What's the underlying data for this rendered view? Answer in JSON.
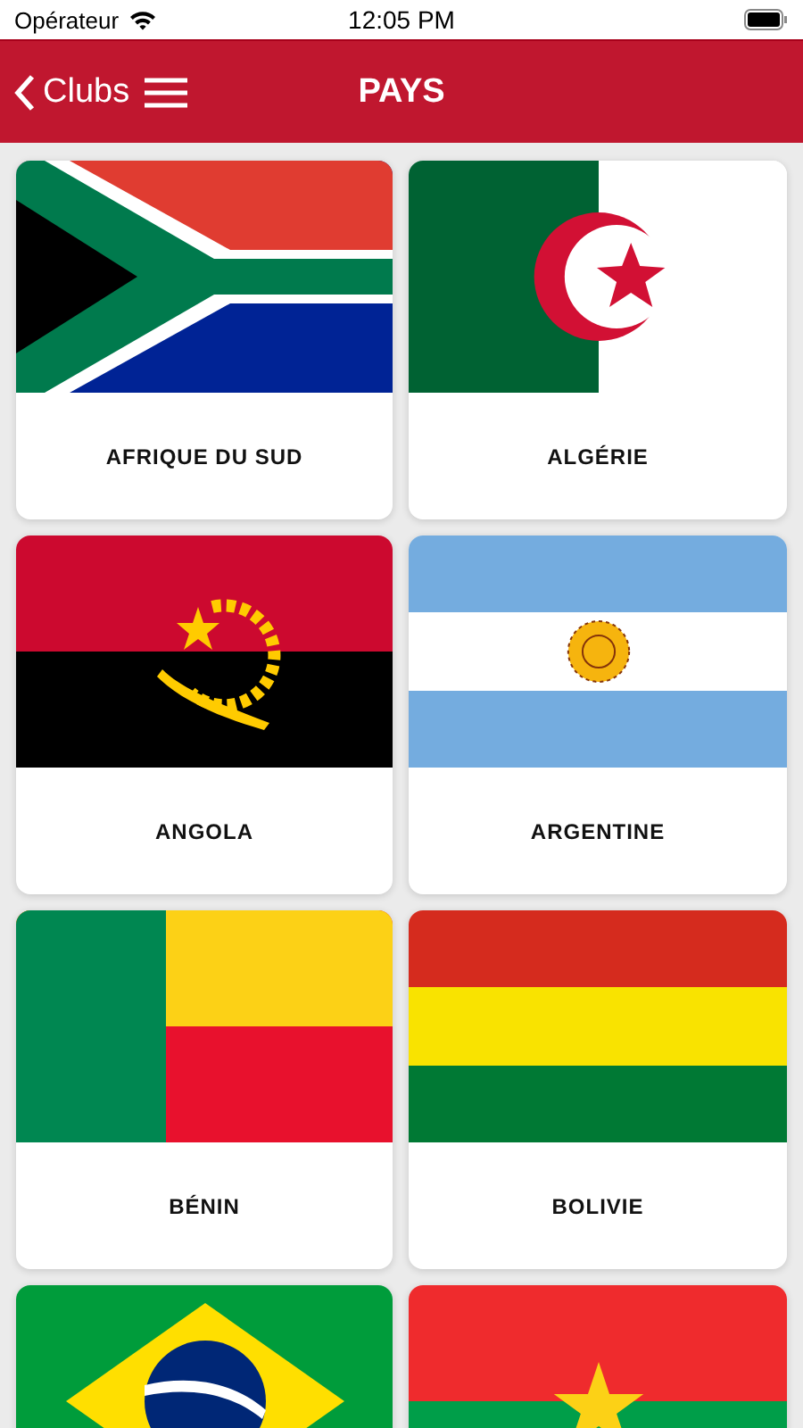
{
  "status_bar": {
    "carrier": "Opérateur",
    "time": "12:05 PM"
  },
  "header": {
    "back_label": "Clubs",
    "title": "PAYS"
  },
  "countries": [
    {
      "name": "AFRIQUE DU SUD",
      "kind": "south-africa"
    },
    {
      "name": "ALGÉRIE",
      "kind": "algeria"
    },
    {
      "name": "ANGOLA",
      "kind": "angola"
    },
    {
      "name": "ARGENTINE",
      "kind": "argentina"
    },
    {
      "name": "BÉNIN",
      "kind": "benin"
    },
    {
      "name": "BOLIVIE",
      "kind": "bolivia"
    },
    {
      "kind": "brazil"
    },
    {
      "kind": "burkina"
    }
  ]
}
